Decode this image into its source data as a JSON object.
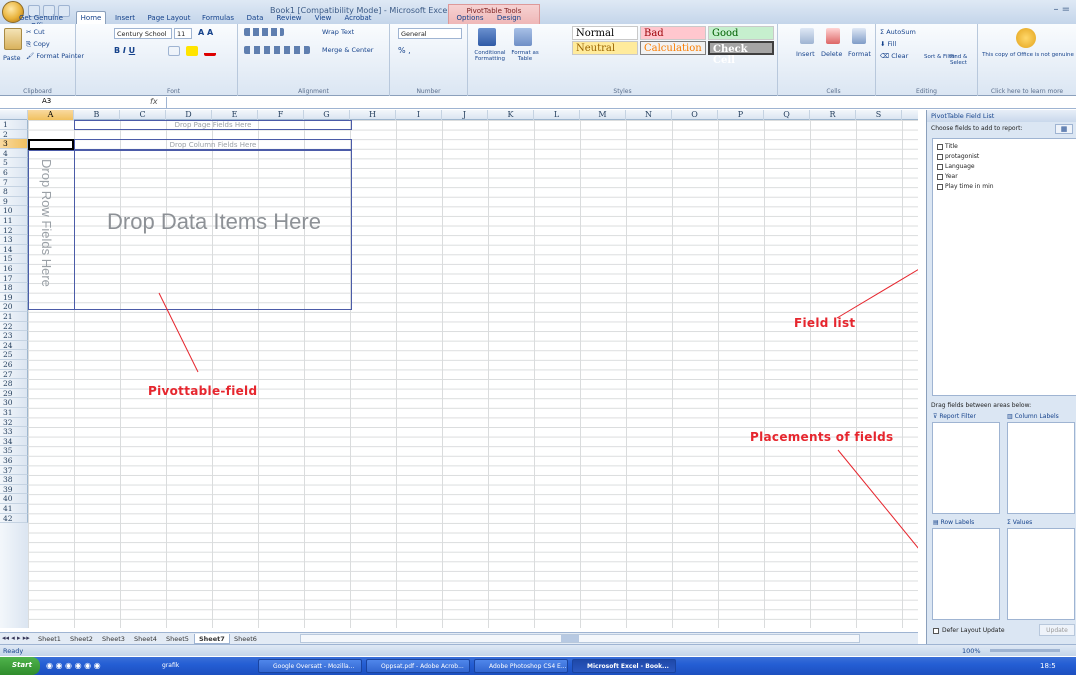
{
  "app": {
    "document_title": "Book1 [Compatibility Mode] - Microsoft Excel",
    "contextual_tab_group": "PivotTable Tools",
    "window_controls": "– ="
  },
  "ribbon_tabs": [
    "Get Genuine Office",
    "Home",
    "Insert",
    "Page Layout",
    "Formulas",
    "Data",
    "Review",
    "View",
    "Acrobat",
    "Options",
    "Design"
  ],
  "ribbon": {
    "clipboard": {
      "paste": "Paste",
      "cut": "Cut",
      "copy": "Copy",
      "format_painter": "Format Painter",
      "label": "Clipboard"
    },
    "font": {
      "family": "Century School",
      "size": "11",
      "label": "Font"
    },
    "alignment": {
      "wrap_text": "Wrap Text",
      "merge_center": "Merge & Center",
      "label": "Alignment"
    },
    "number": {
      "format": "General",
      "label": "Number",
      "symbols": "% ,"
    },
    "styles": {
      "conditional_formatting": "Conditional Formatting",
      "format_as_table": "Format as Table",
      "label": "Styles",
      "cells": {
        "normal": "Normal",
        "bad": "Bad",
        "good": "Good",
        "neutral": "Neutral",
        "calculation": "Calculation",
        "check_cell": "Check Cell"
      }
    },
    "cells": {
      "insert": "Insert",
      "delete": "Delete",
      "format": "Format",
      "label": "Cells"
    },
    "editing": {
      "autosum": "AutoSum",
      "fill": "Fill",
      "clear": "Clear",
      "sort_filter": "Sort & Filter",
      "find_select": "Find & Select",
      "label": "Editing"
    },
    "genuine": {
      "text": "This copy of Office is not genuine",
      "link": "Click here to learn more"
    }
  },
  "formula_bar": {
    "name_box": "A3",
    "fx": "fx",
    "value": ""
  },
  "columns": [
    "A",
    "B",
    "C",
    "D",
    "E",
    "F",
    "G",
    "H",
    "I",
    "J",
    "K",
    "L",
    "M",
    "N",
    "O",
    "P",
    "Q",
    "R",
    "S"
  ],
  "rows": [
    "1",
    "2",
    "3",
    "4",
    "5",
    "6",
    "7",
    "8",
    "9",
    "10",
    "11",
    "12",
    "13",
    "14",
    "15",
    "16",
    "17",
    "18",
    "19",
    "20",
    "21",
    "22",
    "23",
    "24",
    "25",
    "26",
    "27",
    "28",
    "29",
    "30",
    "31",
    "32",
    "33",
    "34",
    "35",
    "36",
    "37",
    "38",
    "39",
    "40",
    "41",
    "42"
  ],
  "pivot": {
    "page_fields": "Drop Page Fields Here",
    "column_fields": "Drop Column Fields Here",
    "row_fields": "Drop Row Fields Here",
    "data_items": "Drop Data Items Here"
  },
  "annotations": {
    "pivottable": "Pivottable-field",
    "field_list": "Field list",
    "placements": "Placements of fields"
  },
  "panel": {
    "title": "PivotTable Field List",
    "choose_fields": "Choose fields to add to report:",
    "fields": [
      "Title",
      "protagonist",
      "Language",
      "Year",
      "Play time in min"
    ],
    "drag_hint": "Drag fields between areas below:",
    "report_filter": "Report Filter",
    "column_labels": "Column Labels",
    "row_labels": "Row Labels",
    "values": "Values",
    "defer_update": "Defer Layout Update",
    "update": "Update"
  },
  "sheet_tabs": [
    "Sheet1",
    "Sheet2",
    "Sheet3",
    "Sheet4",
    "Sheet5",
    "Sheet7",
    "Sheet6"
  ],
  "active_sheet": "Sheet7",
  "status": {
    "ready": "Ready",
    "zoom": "100%"
  },
  "taskbar": {
    "start": "Start",
    "items": [
      "grafik",
      "Google Oversatt - Mozilla...",
      "Oppsat.pdf - Adobe Acrob...",
      "Adobe Photoshop CS4 E...",
      "Microsoft Excel - Book..."
    ],
    "clock": "18:5"
  },
  "colors": {
    "annotation": "#e6262e",
    "accent": "#15428b",
    "pivot_border": "#4b5ba8"
  }
}
